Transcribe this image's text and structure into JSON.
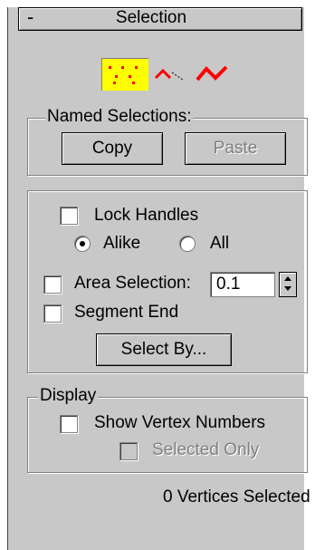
{
  "rollout": {
    "collapse_symbol": "-",
    "title": "Selection"
  },
  "subobject_levels": [
    {
      "name": "vertex",
      "icon": "vertex-icon",
      "active": true
    },
    {
      "name": "segment",
      "icon": "segment-icon",
      "active": false
    },
    {
      "name": "spline",
      "icon": "spline-icon",
      "active": false
    }
  ],
  "named_selections": {
    "legend": "Named Selections:",
    "copy_label": "Copy",
    "paste_label": "Paste"
  },
  "options": {
    "lock_handles_label": "Lock Handles",
    "lock_handles_checked": false,
    "alike_label": "Alike",
    "all_label": "All",
    "handle_mode_selected": "Alike",
    "area_selection_label": "Area Selection:",
    "area_selection_checked": false,
    "area_selection_value": "0.1",
    "segment_end_label": "Segment End",
    "segment_end_checked": false,
    "select_by_label": "Select By..."
  },
  "display": {
    "legend": "Display",
    "show_vertex_numbers_label": "Show Vertex Numbers",
    "show_vertex_numbers_checked": false,
    "selected_only_label": "Selected Only",
    "selected_only_checked": false
  },
  "status_text": "0 Vertices Selected",
  "colors": {
    "panel_bg": "#c8c8c8",
    "active_subobject": "#ffff00",
    "icon_red": "#ff0000"
  }
}
